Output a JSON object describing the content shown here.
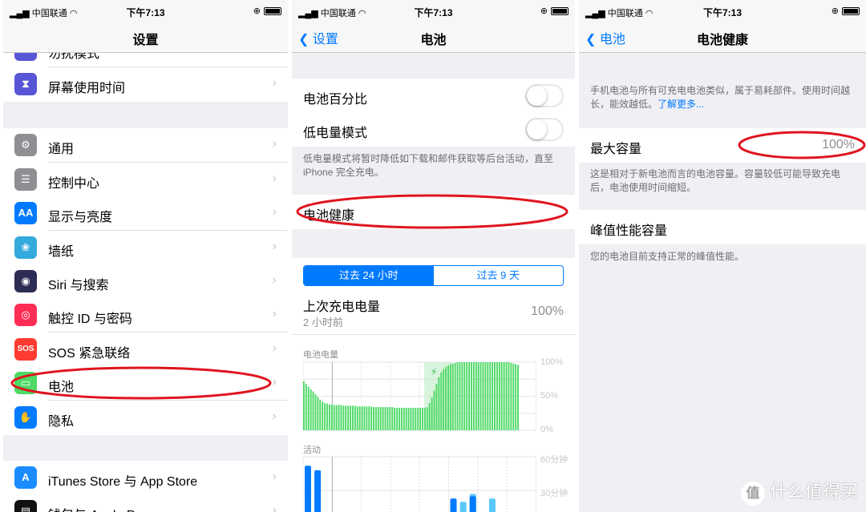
{
  "status_bar": {
    "carrier": "中国联通",
    "time": "下午7:13"
  },
  "settings": {
    "title": "设置",
    "items": [
      {
        "label": "勿扰模式",
        "icon": "moon-icon",
        "color": "#5856d6",
        "glyph": "☾"
      },
      {
        "label": "屏幕使用时间",
        "icon": "hourglass-icon",
        "color": "#5856d6",
        "glyph": "⧗"
      },
      {
        "label": "通用",
        "icon": "gear-icon",
        "color": "#8e8e93",
        "glyph": "⚙"
      },
      {
        "label": "控制中心",
        "icon": "switches-icon",
        "color": "#8e8e93",
        "glyph": "☰"
      },
      {
        "label": "显示与亮度",
        "icon": "display-icon",
        "color": "#007aff",
        "glyph": "AA"
      },
      {
        "label": "墙纸",
        "icon": "wallpaper-flower-icon",
        "color": "#34aadc",
        "glyph": "❀"
      },
      {
        "label": "Siri 与搜索",
        "icon": "siri-icon",
        "color": "#2c2c54",
        "glyph": "◉"
      },
      {
        "label": "触控 ID 与密码",
        "icon": "fingerprint-icon",
        "color": "#ff2d55",
        "glyph": "◎"
      },
      {
        "label": "SOS 紧急联络",
        "icon": "sos-icon",
        "color": "#ff3b30",
        "glyph": "SOS"
      },
      {
        "label": "电池",
        "icon": "battery-icon",
        "color": "#4cd964",
        "glyph": "▭"
      },
      {
        "label": "隐私",
        "icon": "hand-icon",
        "color": "#007aff",
        "glyph": "✋"
      },
      {
        "label": "iTunes Store 与 App Store",
        "icon": "app-store-icon",
        "color": "#1a8cff",
        "glyph": "A"
      },
      {
        "label": "钱包与 Apple Pay",
        "icon": "wallet-icon",
        "color": "#111111",
        "glyph": "▤"
      }
    ]
  },
  "battery": {
    "back": "设置",
    "title": "电池",
    "percentage_label": "电池百分比",
    "percentage_on": false,
    "low_power_label": "低电量模式",
    "low_power_on": false,
    "low_power_footer": "低电量模式将暂时降低如下载和邮件获取等后台活动，直至 iPhone 完全充电。",
    "health_label": "电池健康",
    "tabs": [
      "过去 24 小时",
      "过去 9 天"
    ],
    "active_tab": 0,
    "last_charge_label": "上次充电电量",
    "last_charge_time": "2 小时前",
    "last_charge_value": "100%"
  },
  "health": {
    "back": "电池",
    "title": "电池健康",
    "intro": "手机电池与所有可充电电池类似，属于易耗部件。使用时间越长，能效越低。",
    "learn_more": "了解更多...",
    "max_capacity_label": "最大容量",
    "max_capacity_value": "100%",
    "max_capacity_footer": "这是相对于新电池而言的电池容量。容量较低可能导致充电后，电池使用时间缩短。",
    "peak_label": "峰值性能容量",
    "peak_footer": "您的电池目前支持正常的峰值性能。"
  },
  "chart_data": [
    {
      "type": "bar",
      "title": "电池电量",
      "yticks": [
        "100%",
        "50%",
        "0%"
      ],
      "ylim": [
        0,
        100
      ],
      "color": "#4cd964",
      "values": [
        72,
        68,
        64,
        60,
        57,
        53,
        49,
        45,
        42,
        40,
        39,
        38,
        38,
        37,
        37,
        37,
        37,
        36,
        36,
        36,
        36,
        36,
        36,
        35,
        35,
        35,
        35,
        35,
        35,
        35,
        34,
        34,
        34,
        34,
        34,
        34,
        34,
        34,
        34,
        33,
        33,
        33,
        33,
        33,
        33,
        33,
        33,
        33,
        33,
        33,
        33,
        33,
        33,
        34,
        40,
        48,
        58,
        68,
        78,
        85,
        90,
        93,
        95,
        97,
        98,
        99,
        100,
        100,
        100,
        100,
        100,
        100,
        100,
        100,
        100,
        100,
        100,
        100,
        100,
        100,
        100,
        100,
        100,
        100,
        100,
        100,
        100,
        100,
        100,
        99,
        98,
        97,
        96
      ],
      "charging_range": [
        52,
        64
      ]
    },
    {
      "type": "bar",
      "title": "活动",
      "yticks": [
        "60分钟",
        "30分钟"
      ],
      "ylim": [
        0,
        60
      ],
      "unit": "分钟",
      "series": [
        {
          "color": "#007aff",
          "values": {
            "0": 52,
            "1": 48,
            "13": 3,
            "15": 23,
            "17": 25,
            "19": 7
          }
        },
        {
          "color": "#5ac8fa",
          "values": {
            "13": 2,
            "16": 20,
            "17": 2,
            "19": 16
          }
        }
      ]
    }
  ],
  "watermark": "什么值得买",
  "watermark_logo": "值",
  "annotation_color": "#e0141e"
}
